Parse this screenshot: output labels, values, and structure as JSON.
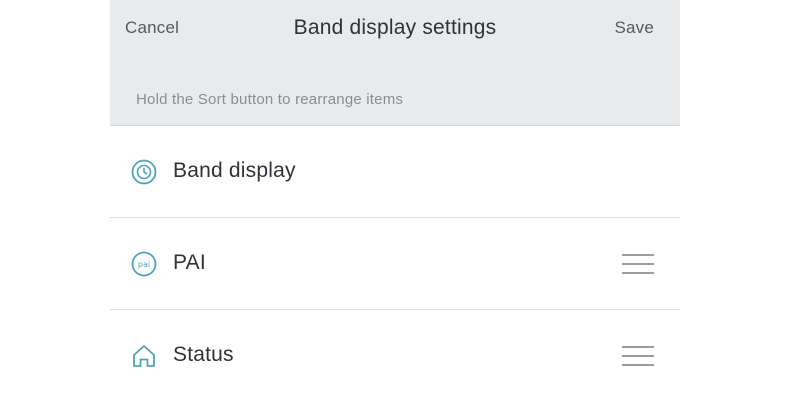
{
  "navbar": {
    "cancel_label": "Cancel",
    "title": "Band display settings",
    "save_label": "Save"
  },
  "hint": {
    "text": "Hold the Sort button to rearrange items"
  },
  "rows": [
    {
      "label": "Band display",
      "icon": "clock-icon",
      "sortable": false
    },
    {
      "label": "PAI",
      "icon": "pai-icon",
      "sortable": true
    },
    {
      "label": "Status",
      "icon": "home-icon",
      "sortable": true
    }
  ],
  "icons": {
    "pai_badge_text": "pai"
  },
  "colors": {
    "accent": "#4fa3b8",
    "header_bg": "#e9eaeb",
    "text_primary": "#2f3337",
    "text_secondary": "#8a8e92",
    "divider": "#d9dbdd",
    "handle": "#9a9da0"
  }
}
